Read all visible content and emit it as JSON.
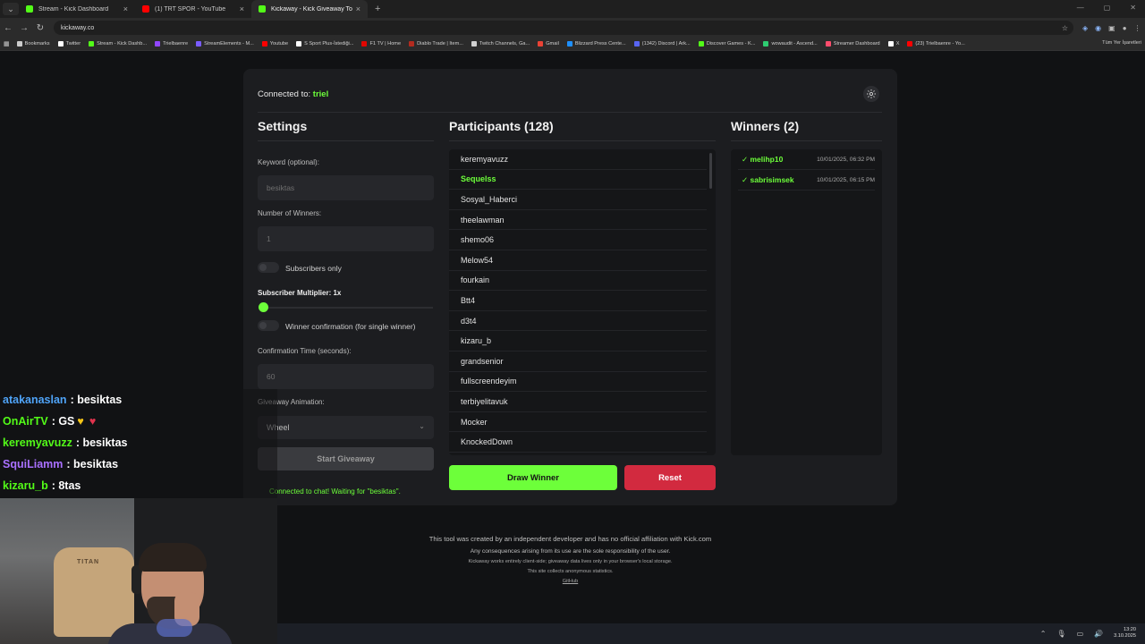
{
  "browser": {
    "tabs": [
      {
        "title": "Stream - Kick Dashboard",
        "color": "#53fc18",
        "active": false
      },
      {
        "title": "(1) TRT SPOR - YouTube",
        "color": "#ff0000",
        "active": false
      },
      {
        "title": "Kickaway - Kick Giveaway Tool",
        "color": "#53fc18",
        "active": true
      }
    ],
    "url": "kickaway.co",
    "bookmarks": [
      {
        "label": "Bookmarks",
        "color": "#cccccc"
      },
      {
        "label": "Twitter",
        "color": "#ffffff"
      },
      {
        "label": "Stream - Kick Dashb...",
        "color": "#53fc18"
      },
      {
        "label": "Trielbaenre",
        "color": "#9146ff"
      },
      {
        "label": "StreamElements - M...",
        "color": "#7a5cff"
      },
      {
        "label": "Youtube",
        "color": "#ff0000"
      },
      {
        "label": "S Sport Plus-İstediği...",
        "color": "#ffffff"
      },
      {
        "label": "F1 TV | Home",
        "color": "#e10600"
      },
      {
        "label": "Diablo Trade | Item...",
        "color": "#b32b1f"
      },
      {
        "label": "Twitch Channels, Ga...",
        "color": "#d0d0d0"
      },
      {
        "label": "Gmail",
        "color": "#ea4335"
      },
      {
        "label": "Blizzard Press Cente...",
        "color": "#1e90ff"
      },
      {
        "label": "(1342) Discord | Ark...",
        "color": "#5865f2"
      },
      {
        "label": "Discover Games - K...",
        "color": "#53fc18"
      },
      {
        "label": "wowaudit - Ascend...",
        "color": "#2ecc71"
      },
      {
        "label": "Streamer Dashboard",
        "color": "#ff4d6d"
      },
      {
        "label": "X",
        "color": "#ffffff"
      },
      {
        "label": "(23) Trielbaenre - Yo...",
        "color": "#ff0000"
      }
    ],
    "bookmarks_right": "Tüm Yer İşaretleri"
  },
  "app": {
    "connected_label": "Connected to:",
    "connected_user": "triel",
    "settings": {
      "title": "Settings",
      "keyword_label": "Keyword (optional):",
      "keyword_value": "besiktas",
      "winners_label": "Number of Winners:",
      "winners_value": "1",
      "subscribers_only": "Subscribers only",
      "multiplier_label": "Subscriber Multiplier: 1x",
      "multiplier_value": 1,
      "winner_confirmation": "Winner confirmation (for single winner)",
      "confirmation_label": "Confirmation Time (seconds):",
      "confirmation_value": "60",
      "animation_label": "Giveaway Animation:",
      "animation_value": "Wheel",
      "start_button": "Start Giveaway",
      "status": "Connected to chat! Waiting for \"besiktas\"."
    },
    "participants": {
      "title": "Participants (128)",
      "items": [
        {
          "name": "keremyavuzz",
          "highlight": false
        },
        {
          "name": "Sequelss",
          "highlight": true
        },
        {
          "name": "Sosyal_Haberci",
          "highlight": false
        },
        {
          "name": "theelawman",
          "highlight": false
        },
        {
          "name": "shemo06",
          "highlight": false
        },
        {
          "name": "Melow54",
          "highlight": false
        },
        {
          "name": "fourkain",
          "highlight": false
        },
        {
          "name": "Btt4",
          "highlight": false
        },
        {
          "name": "d3t4",
          "highlight": false
        },
        {
          "name": "kizaru_b",
          "highlight": false
        },
        {
          "name": "grandsenior",
          "highlight": false
        },
        {
          "name": "fullscreendeyim",
          "highlight": false
        },
        {
          "name": "terbiyelitavuk",
          "highlight": false
        },
        {
          "name": "Mocker",
          "highlight": false
        },
        {
          "name": "KnockedDown",
          "highlight": false
        }
      ],
      "draw_button": "Draw Winner",
      "reset_button": "Reset"
    },
    "winners": {
      "title": "Winners (2)",
      "items": [
        {
          "name": "✓ melihp10",
          "date": "10/01/2025, 06:32 PM"
        },
        {
          "name": "✓ sabrisimsek",
          "date": "10/01/2025, 06:15 PM"
        }
      ]
    },
    "footer": {
      "line1": "This tool was created by an independent developer and has no official affiliation with Kick.com",
      "line2": "Any consequences arising from its use are the sole responsibility of the user.",
      "line3": "Kickaway works entirely client-side; giveaway data lives only in your browser's local storage.",
      "line4": "This site collects anonymous statistics.",
      "line5": "GitHub"
    }
  },
  "chat": [
    {
      "user": "atakanaslan",
      "color": "#4fa3f7",
      "message": ": besiktas",
      "hearts": false
    },
    {
      "user": "OnAirTV",
      "color": "#53fc18",
      "message": ": GS",
      "hearts": true
    },
    {
      "user": "keremyavuzz",
      "color": "#53fc18",
      "message": ": besiktas",
      "hearts": false
    },
    {
      "user": "SquiLiamm",
      "color": "#a970ff",
      "message": ": besiktas",
      "hearts": false
    },
    {
      "user": "kizaru_b",
      "color": "#53fc18",
      "message": ": 8tas",
      "hearts": false
    }
  ],
  "webcam": {
    "chair_logo": "TITAN"
  },
  "taskbar": {
    "time": "13:20",
    "date": "3.10.2025"
  }
}
